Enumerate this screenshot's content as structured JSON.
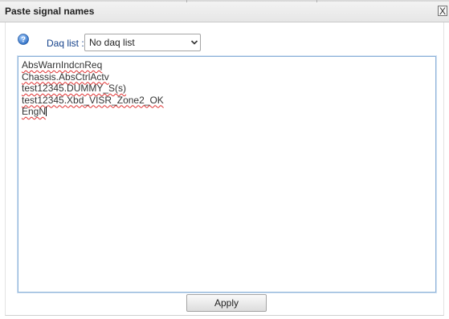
{
  "dialog": {
    "title": "Paste signal names",
    "close_glyph": "X"
  },
  "daq": {
    "label": "Daq list :",
    "selected": "No daq list"
  },
  "signals": {
    "lines": [
      "AbsWarnIndcnReq",
      "Chassis.AbsCtrlActv",
      "test12345.DUMMY_S(s)",
      "test12345.Xbd_VISR_Zone2_OK",
      "EngN"
    ]
  },
  "buttons": {
    "apply": "Apply"
  },
  "icons": {
    "help": "help-icon",
    "close": "close-icon",
    "dropdown": "chevron-down-icon"
  },
  "colors": {
    "label_text": "#15428b",
    "help_icon": "#3a78c9",
    "textarea_border": "#8fb3d9",
    "spellcheck_underline": "#e03030"
  }
}
